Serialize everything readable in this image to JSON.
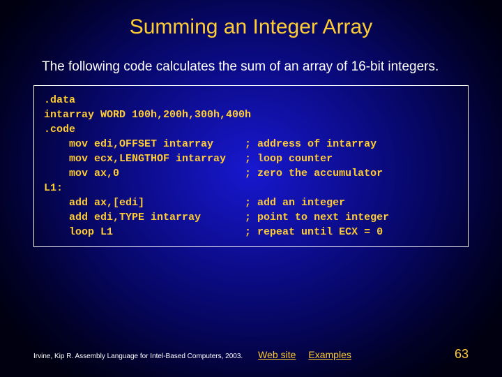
{
  "title": "Summing an Integer Array",
  "intro": "The following code calculates the sum of an array of 16-bit integers.",
  "code": ".data\nintarray WORD 100h,200h,300h,400h\n.code\n    mov edi,OFFSET intarray     ; address of intarray\n    mov ecx,LENGTHOF intarray   ; loop counter\n    mov ax,0                    ; zero the accumulator\nL1:\n    add ax,[edi]                ; add an integer\n    add edi,TYPE intarray       ; point to next integer\n    loop L1                     ; repeat until ECX = 0",
  "footer": {
    "credit": "Irvine, Kip R. Assembly Language for Intel-Based Computers, 2003.",
    "link_web": "Web site",
    "link_examples": "Examples",
    "pagenum": "63"
  }
}
